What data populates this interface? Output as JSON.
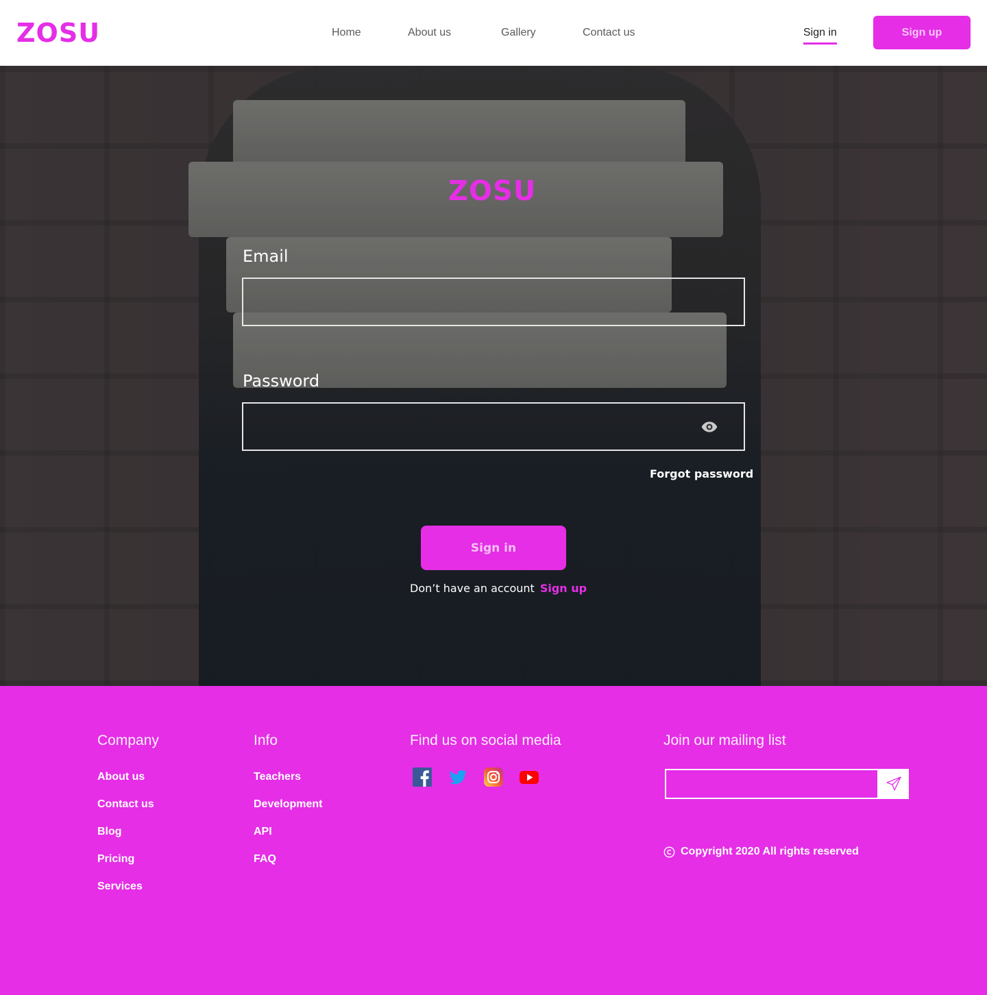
{
  "header": {
    "logo": "ZOSU",
    "nav": [
      "Home",
      "About us",
      "Gallery",
      "Contact us"
    ],
    "sign_in": "Sign in",
    "sign_up": "Sign up"
  },
  "login": {
    "logo": "ZOSU",
    "email_label": "Email",
    "email_value": "",
    "password_label": "Password",
    "password_value": "",
    "password_toggle_icon": "eye-icon",
    "forgot_password": "Forgot password",
    "sign_in_button": "Sign in",
    "no_account_text": "Don’t have an account",
    "sign_up_link": "Sign up"
  },
  "footer": {
    "company": {
      "title": "Company",
      "links": [
        "About us",
        "Contact us",
        "Blog",
        "Pricing",
        "Services"
      ]
    },
    "info": {
      "title": "Info",
      "links": [
        "Teachers",
        "Development",
        "API",
        "FAQ"
      ]
    },
    "social": {
      "title": "Find us on social media",
      "icons": [
        "facebook-icon",
        "twitter-icon",
        "instagram-icon",
        "youtube-icon"
      ]
    },
    "mailing": {
      "title": "Join our mailing list",
      "input_value": "",
      "send_icon": "paper-plane-icon"
    },
    "copyright": "Copyright 2020  All rights reserved"
  },
  "colors": {
    "brand": "#e52ee6",
    "text_dark": "#222222",
    "nav_text": "#5b5b5b",
    "white": "#ffffff"
  }
}
